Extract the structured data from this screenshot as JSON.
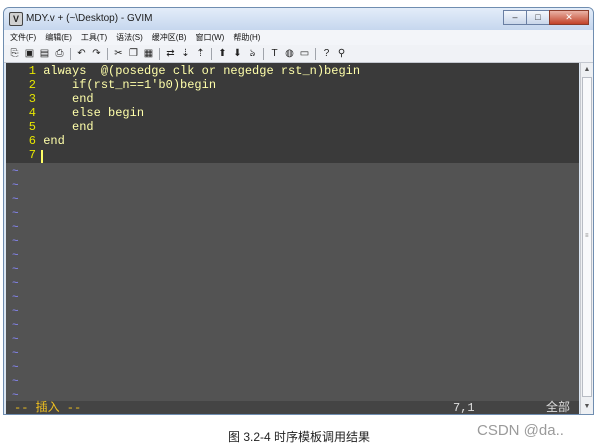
{
  "window": {
    "title": "MDY.v + (~\\Desktop) - GVIM"
  },
  "menu": [
    {
      "label": "文件(F)"
    },
    {
      "label": "编辑(E)"
    },
    {
      "label": "工具(T)"
    },
    {
      "label": "语法(S)"
    },
    {
      "label": "缓冲区(B)"
    },
    {
      "label": "窗口(W)"
    },
    {
      "label": "帮助(H)"
    }
  ],
  "toolbar": {
    "icons": [
      {
        "name": "open-icon",
        "glyph": "⎘"
      },
      {
        "name": "save-icon",
        "glyph": "▣"
      },
      {
        "name": "save-all-icon",
        "glyph": "▤"
      },
      {
        "name": "print-icon",
        "glyph": "⎙"
      },
      {
        "name": "undo-icon",
        "glyph": "↶"
      },
      {
        "name": "redo-icon",
        "glyph": "↷"
      },
      {
        "name": "cut-icon",
        "glyph": "✂"
      },
      {
        "name": "copy-icon",
        "glyph": "❐"
      },
      {
        "name": "paste-icon",
        "glyph": "▦"
      },
      {
        "name": "replace-icon",
        "glyph": "⇄"
      },
      {
        "name": "find-next-icon",
        "glyph": "⇣"
      },
      {
        "name": "find-prev-icon",
        "glyph": "⇡"
      },
      {
        "name": "load-session-icon",
        "glyph": "⬆"
      },
      {
        "name": "save-session-icon",
        "glyph": "⬇"
      },
      {
        "name": "run-script-icon",
        "glyph": "ঌ"
      },
      {
        "name": "make-icon",
        "glyph": "T"
      },
      {
        "name": "shell-icon",
        "glyph": "◍"
      },
      {
        "name": "tags-icon",
        "glyph": "▭"
      },
      {
        "name": "help-icon",
        "glyph": "?"
      },
      {
        "name": "find-help-icon",
        "glyph": "⚲"
      }
    ]
  },
  "editor": {
    "lines": [
      {
        "number": "1",
        "text": "always  @(posedge clk or negedge rst_n)begin"
      },
      {
        "number": "2",
        "text": "    if(rst_n==1'b0)begin"
      },
      {
        "number": "3",
        "text": "    end"
      },
      {
        "number": "4",
        "text": "    else begin"
      },
      {
        "number": "5",
        "text": "    end"
      },
      {
        "number": "6",
        "text": "end"
      },
      {
        "number": "7",
        "text": ""
      }
    ],
    "empty_marker": "~"
  },
  "status": {
    "mode": "-- 插入 --",
    "position": "7,1",
    "percent": "全部"
  },
  "caption": "图 3.2-4 时序模板调用结果",
  "watermark": "CSDN @da.."
}
